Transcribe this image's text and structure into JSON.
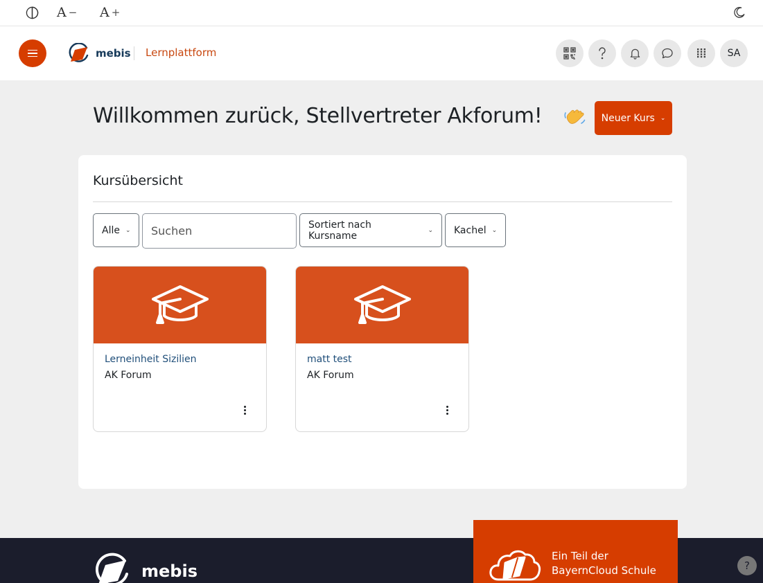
{
  "a11y": {
    "contrast_icon": "contrast-icon",
    "font_smaller_label": "A",
    "font_smaller_sign": "−",
    "font_larger_label": "A",
    "font_larger_sign": "+",
    "dark_mode_icon": "moon-icon"
  },
  "header": {
    "logo_text": "mebis",
    "platform_label": "Lernplattform",
    "icons": [
      "qr-code-icon",
      "help-icon",
      "bell-icon",
      "chat-icon",
      "apps-grid-icon"
    ],
    "avatar_initials": "SA",
    "accent_color": "#d63d00"
  },
  "main": {
    "welcome": "Willkommen zurück, Stellvertreter Akforum!",
    "new_course_label": "Neuer Kurs"
  },
  "course_overview": {
    "title": "Kursübersicht",
    "filter_label": "Alle",
    "search_placeholder": "Suchen",
    "sort_label": "Sortiert nach Kursname",
    "view_label": "Kachel",
    "courses": [
      {
        "name": "Lerneinheit Sizilien",
        "category": "AK Forum"
      },
      {
        "name": "matt test",
        "category": "AK Forum"
      }
    ]
  },
  "footer": {
    "logo_text": "mebis",
    "bayern_line1": "Ein Teil der",
    "bayern_line2": "BayernCloud Schule",
    "help_label": "?"
  }
}
